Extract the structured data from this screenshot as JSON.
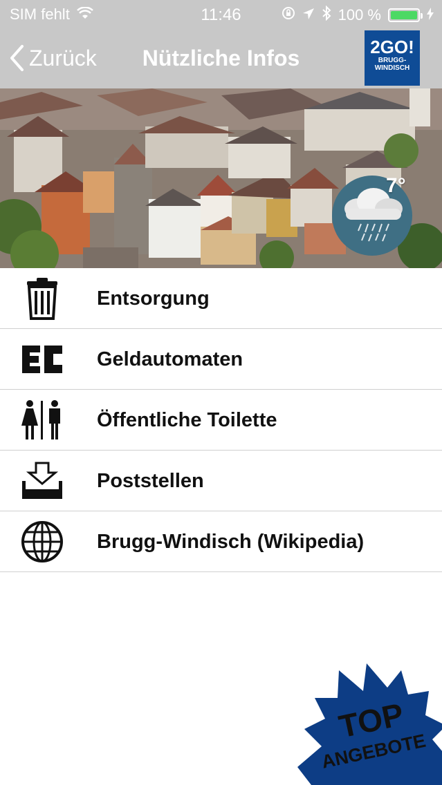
{
  "status_bar": {
    "carrier": "SIM fehlt",
    "time": "11:46",
    "battery": "100 %",
    "battery_level": 1.0
  },
  "nav": {
    "back_label": "Zurück",
    "title": "Nützliche Infos",
    "logo_main": "2GO!",
    "logo_sub_1": "BRUGG-",
    "logo_sub_2": "WINDISCH"
  },
  "weather": {
    "temperature": "7°",
    "icon": "rain-cloud-icon"
  },
  "menu": [
    {
      "label": "Entsorgung",
      "icon": "trash-icon"
    },
    {
      "label": "Geldautomaten",
      "icon": "ec-card-icon"
    },
    {
      "label": "Öffentliche Toilette",
      "icon": "toilet-icon"
    },
    {
      "label": "Poststellen",
      "icon": "inbox-download-icon"
    },
    {
      "label": "Brugg-Windisch (Wikipedia)",
      "icon": "globe-icon"
    }
  ],
  "badge": {
    "line1": "TOP",
    "line2": "ANGEBOTE"
  },
  "colors": {
    "bar_gray": "#c8c8c8",
    "brand_blue": "#0f4c96",
    "badge_blue": "#0d3d85",
    "battery_green": "#4cd964"
  }
}
